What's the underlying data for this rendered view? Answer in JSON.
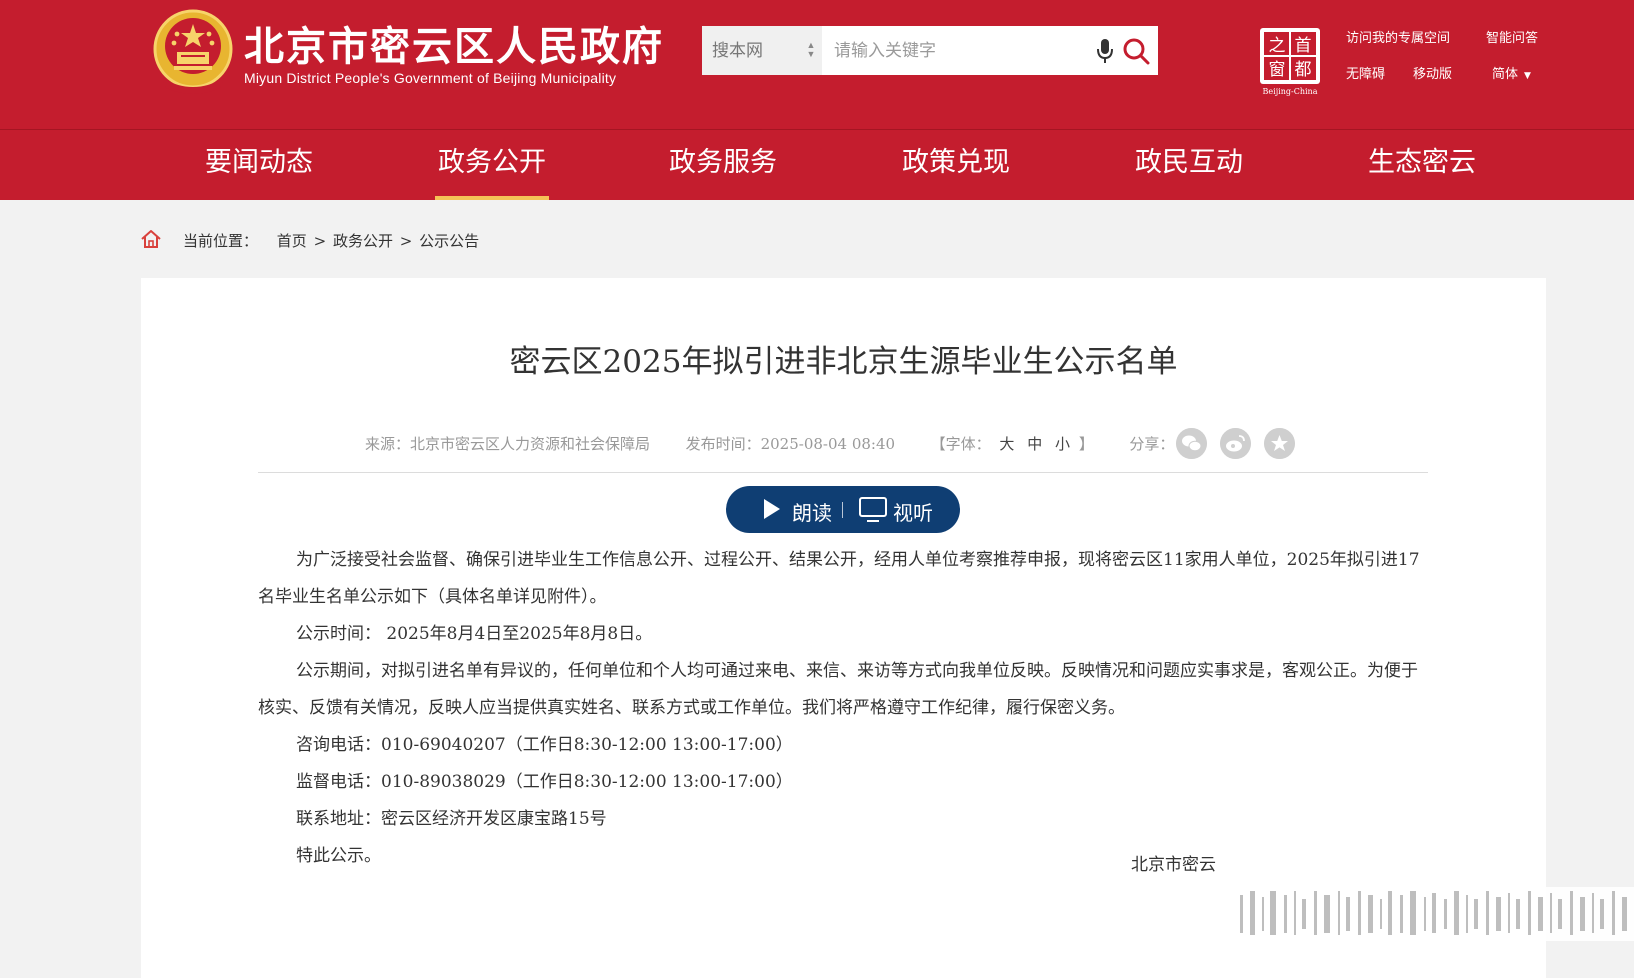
{
  "header": {
    "title": "北京市密云区人民政府",
    "subtitle": "Miyun District People's Government of Beijing Municipality",
    "search": {
      "scope_label": "搜本网",
      "placeholder": "请输入关键字"
    },
    "capital_logo": {
      "top_left": "之",
      "top_right": "首",
      "bottom_left": "窗",
      "bottom_right": "都",
      "caption": "Beijing-China"
    },
    "top_links": {
      "personal_space": "访问我的专属空间",
      "smart_qa": "智能问答",
      "accessibility": "无障碍",
      "mobile": "移动版",
      "language": "简体"
    }
  },
  "nav": {
    "items": [
      "要闻动态",
      "政务公开",
      "政务服务",
      "政策兑现",
      "政民互动",
      "生态密云"
    ],
    "active_index": 1
  },
  "breadcrumb": {
    "prefix": "当前位置：",
    "items": [
      "首页",
      "政务公开",
      "公示公告"
    ],
    "separator": ">"
  },
  "article": {
    "title": "密云区2025年拟引进非北京生源毕业生公示名单",
    "meta": {
      "source": "来源：北京市密云区人力资源和社会保障局",
      "publish_time": "发布时间：2025-08-04 08:40",
      "font_label_open": "【字体：",
      "font_sizes": [
        "大",
        "中",
        "小"
      ],
      "font_label_close": "】",
      "share_label": "分享："
    },
    "listen_button": {
      "read": "朗读",
      "view": "视听"
    },
    "paragraphs": [
      "为广泛接受社会监督、确保引进毕业生工作信息公开、过程公开、结果公开，经用人单位考察推荐申报，现将密云区11家用人单位，2025年拟引进17名毕业生名单公示如下（具体名单详见附件）。",
      "公示时间：  2025年8月4日至2025年8月8日。",
      "公示期间，对拟引进名单有异议的，任何单位和个人均可通过来电、来信、来访等方式向我单位反映。反映情况和问题应实事求是，客观公正。为便于核实、反馈有关情况，反映人应当提供真实姓名、联系方式或工作单位。我们将严格遵守工作纪律，履行保密义务。",
      "咨询电话：010-69040207（工作日8:30-12:00 13:00-17:00）",
      "监督电话：010-89038029（工作日8:30-12:00 13:00-17:00）",
      "联系地址：密云区经济开发区康宝路15号",
      "特此公示。"
    ],
    "signature": "北京市密云"
  },
  "colors": {
    "brand_red": "#c41d2e",
    "nav_active_underline": "#f5c257",
    "listen_button": "#0f3e73"
  }
}
